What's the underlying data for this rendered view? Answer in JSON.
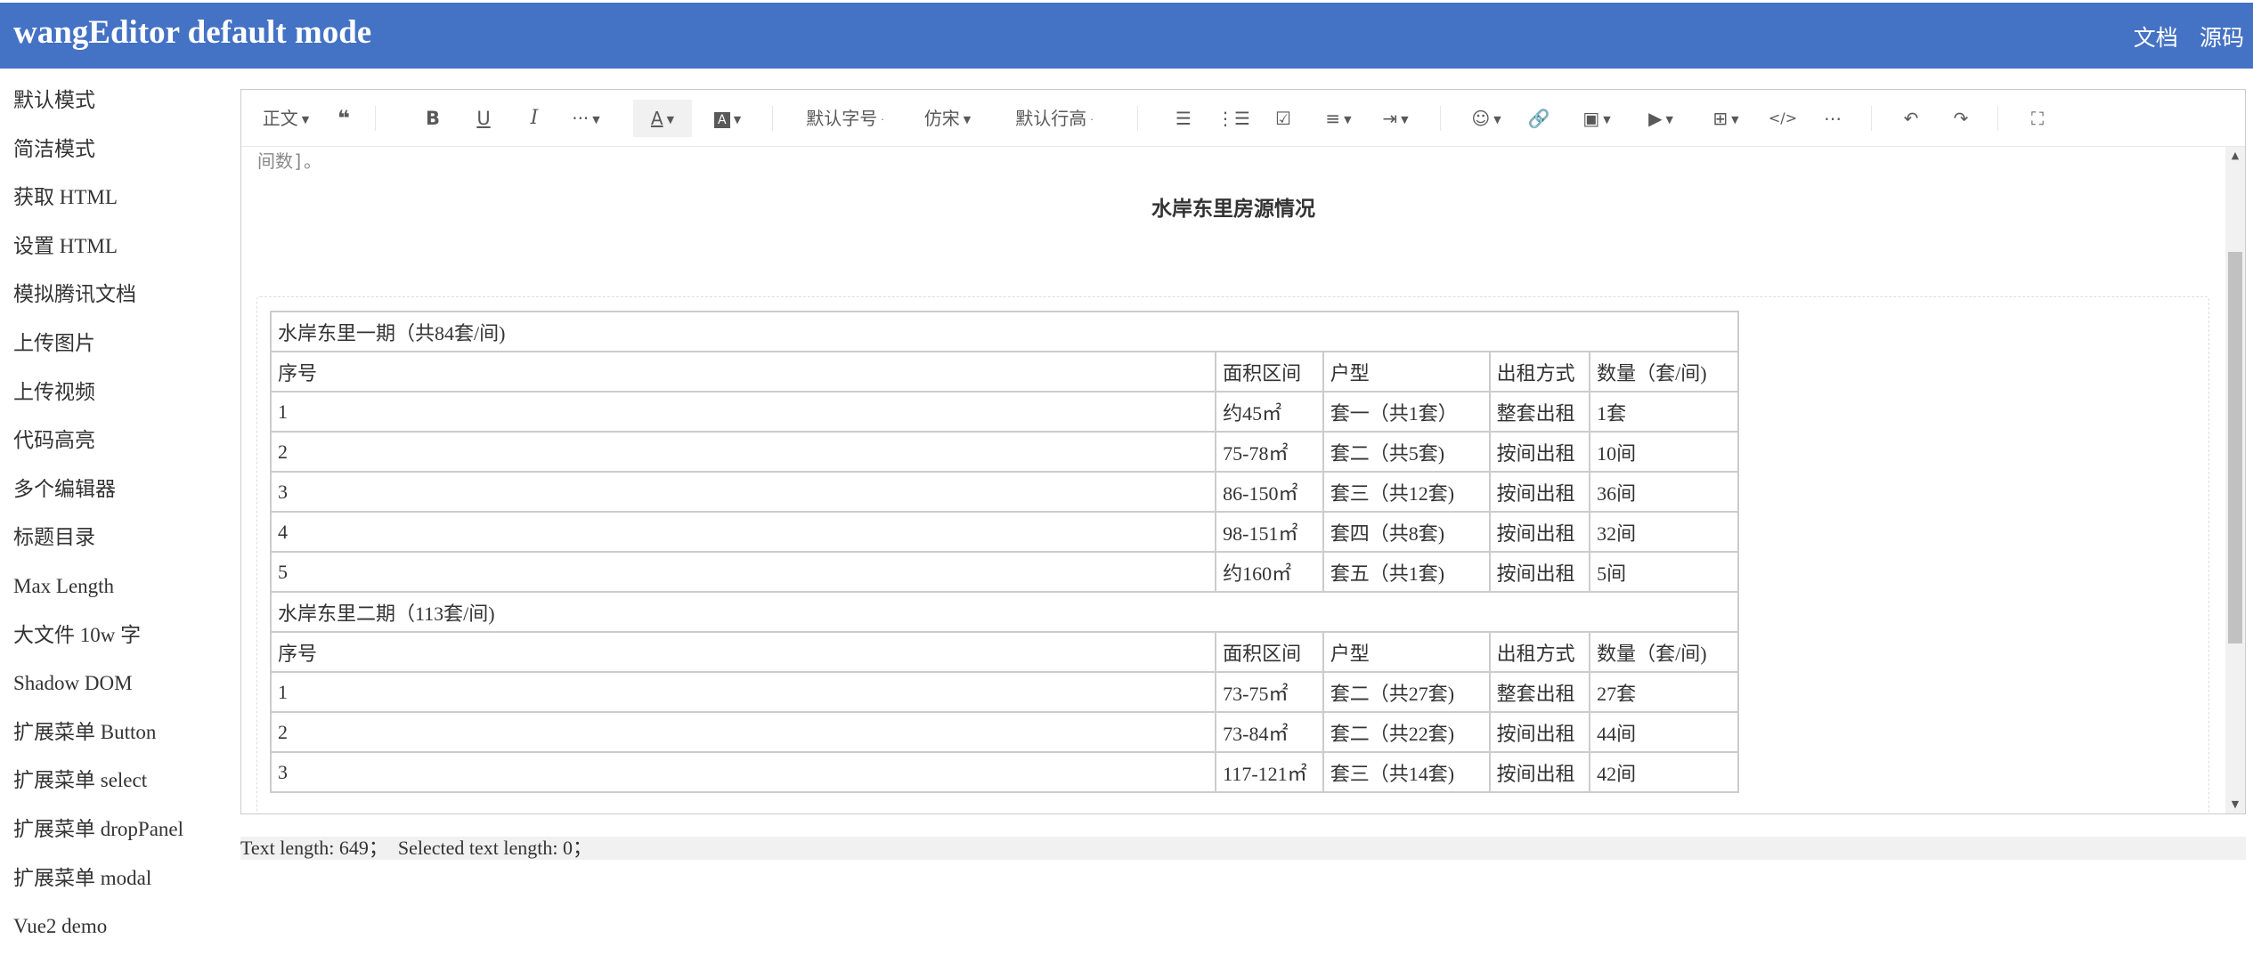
{
  "header": {
    "title": "wangEditor default mode",
    "links": [
      "文档",
      "源码"
    ]
  },
  "sidebar": {
    "items": [
      "默认模式",
      "简洁模式",
      "获取 HTML",
      "设置 HTML",
      "模拟腾讯文档",
      "上传图片",
      "上传视频",
      "代码高亮",
      "多个编辑器",
      "标题目录",
      "Max Length",
      "大文件 10w 字",
      "Shadow DOM",
      "扩展菜单 Button",
      "扩展菜单 select",
      "扩展菜单 dropPanel",
      "扩展菜单 modal",
      "Vue2 demo"
    ]
  },
  "toolbar": {
    "heading": "正文",
    "font_size": "默认字号",
    "font_family": "仿宋",
    "line_height": "默认行高"
  },
  "content": {
    "cut_line": "间数]。",
    "doc_title": "水岸东里房源情况",
    "table": {
      "phase1": "水岸东里一期（共84套/间)",
      "phase2": "水岸东里二期（113套/间)",
      "headers": [
        "序号",
        "面积区间",
        "户型",
        "出租方式",
        "数量（套/间)"
      ],
      "rows1": [
        [
          "1",
          "约45㎡",
          "套一（共1套）",
          "整套出租",
          "1套"
        ],
        [
          "2",
          "75-78㎡",
          "套二（共5套)",
          "按间出租",
          "10间"
        ],
        [
          "3",
          "86-150㎡",
          "套三（共12套)",
          "按间出租",
          "36间"
        ],
        [
          "4",
          "98-151㎡",
          "套四（共8套)",
          "按间出租",
          "32间"
        ],
        [
          "5",
          "约160㎡",
          "套五（共1套)",
          "按间出租",
          "5间"
        ]
      ],
      "rows2": [
        [
          "1",
          "73-75㎡",
          "套二（共27套)",
          "整套出租",
          "27套"
        ],
        [
          "2",
          "73-84㎡",
          "套二（共22套)",
          "按间出租",
          "44间"
        ],
        [
          "3",
          "117-121㎡",
          "套三（共14套)",
          "按间出租",
          "42间"
        ]
      ]
    }
  },
  "status": "Text length: 649；  Selected text length: 0；"
}
